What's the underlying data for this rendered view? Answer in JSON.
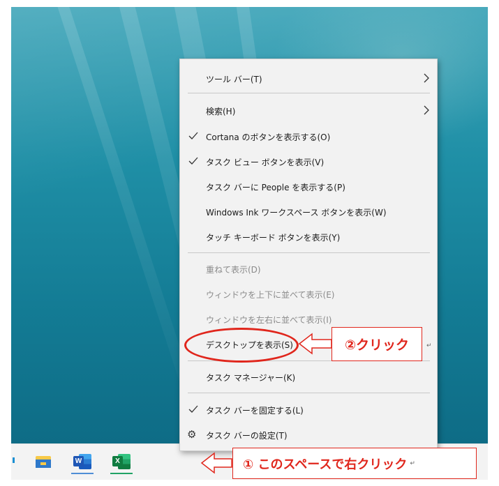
{
  "context_menu": {
    "items": [
      {
        "label": "ツール バー(T)",
        "checked": false,
        "submenu": true,
        "disabled": false
      },
      {
        "label": "検索(H)",
        "checked": false,
        "submenu": true,
        "disabled": false
      },
      {
        "label": "Cortana のボタンを表示する(O)",
        "checked": true,
        "submenu": false,
        "disabled": false
      },
      {
        "label": "タスク ビュー ボタンを表示(V)",
        "checked": true,
        "submenu": false,
        "disabled": false
      },
      {
        "label": "タスク バーに People を表示する(P)",
        "checked": false,
        "submenu": false,
        "disabled": false
      },
      {
        "label": "Windows Ink ワークスペース ボタンを表示(W)",
        "checked": false,
        "submenu": false,
        "disabled": false
      },
      {
        "label": "タッチ キーボード ボタンを表示(Y)",
        "checked": false,
        "submenu": false,
        "disabled": false
      },
      {
        "label": "重ねて表示(D)",
        "checked": false,
        "submenu": false,
        "disabled": true
      },
      {
        "label": "ウィンドウを上下に並べて表示(E)",
        "checked": false,
        "submenu": false,
        "disabled": true
      },
      {
        "label": "ウィンドウを左右に並べて表示(I)",
        "checked": false,
        "submenu": false,
        "disabled": true
      },
      {
        "label": "デスクトップを表示(S)",
        "checked": false,
        "submenu": false,
        "disabled": false
      },
      {
        "label": "タスク マネージャー(K)",
        "checked": false,
        "submenu": false,
        "disabled": false
      },
      {
        "label": "タスク バーを固定する(L)",
        "checked": true,
        "submenu": false,
        "disabled": false
      },
      {
        "label": "タスク バーの設定(T)",
        "checked": false,
        "submenu": false,
        "disabled": false,
        "icon": "gear-icon"
      }
    ]
  },
  "taskbar": {
    "apps": [
      {
        "name": "file-explorer-icon"
      },
      {
        "name": "word-icon",
        "badge": "W"
      },
      {
        "name": "excel-icon",
        "badge": "X"
      }
    ]
  },
  "annotations": {
    "step2_label": "②クリック",
    "step1_label": "① このスペースで右クリック",
    "return_mark": "↵"
  },
  "colors": {
    "annotation_red": "#e0261c",
    "menu_background": "#f2f2f2",
    "taskbar_background": "#f3f3f3",
    "desktop_water": "#1f8fa6"
  }
}
